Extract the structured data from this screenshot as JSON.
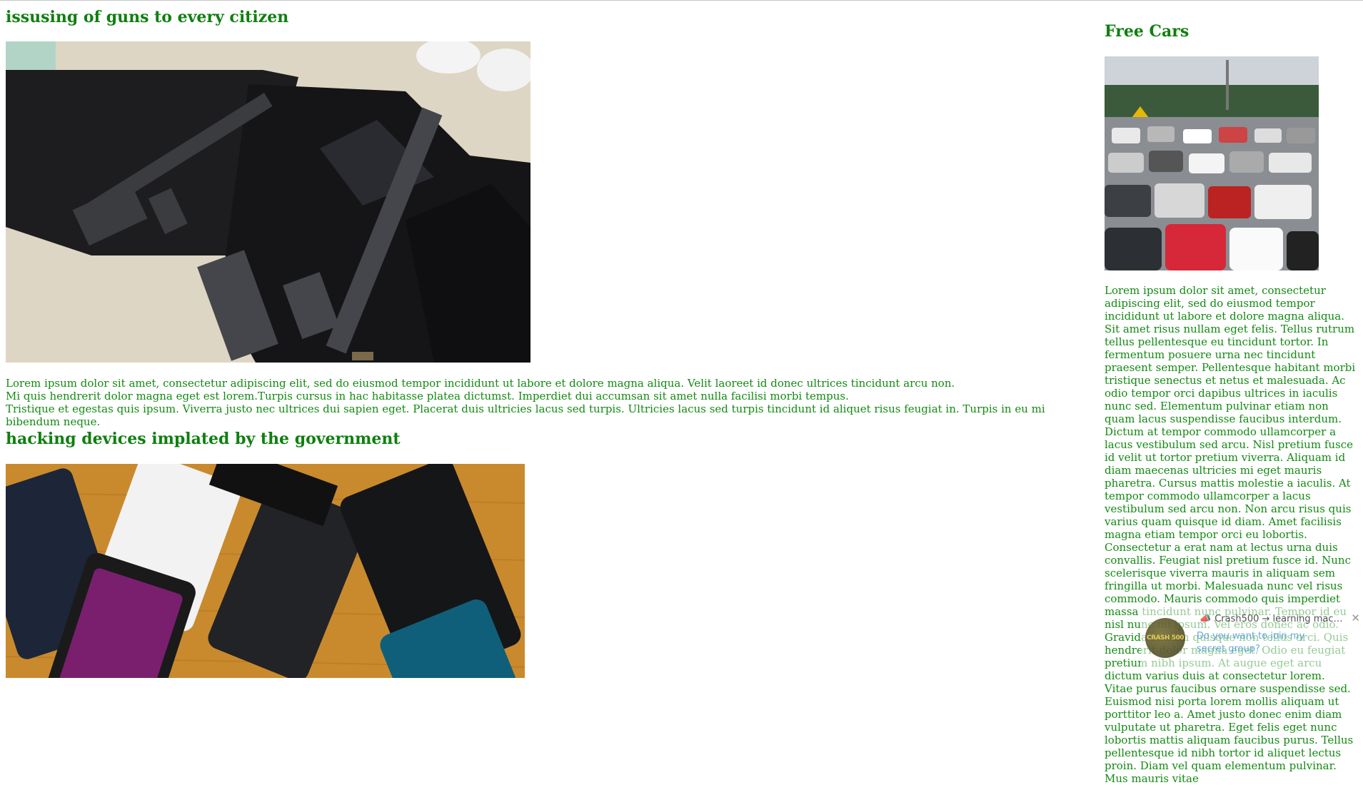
{
  "posts": [
    {
      "title": "issusing of guns to every citizen",
      "paragraphs": [
        "Lorem ipsum dolor sit amet, consectetur adipiscing elit, sed do eiusmod tempor incididunt ut labore et dolore magna aliqua. Velit laoreet id donec ultrices tincidunt arcu non.",
        "Mi quis hendrerit dolor magna eget est lorem.Turpis cursus in hac habitasse platea dictumst. Imperdiet dui accumsan sit amet nulla facilisi morbi tempus.",
        "Tristique et egestas quis ipsum. Viverra justo nec ultrices dui sapien eget. Placerat duis ultricies lacus sed turpis. Ultricies lacus sed turpis tincidunt id aliquet risus feugiat in. Turpis in eu mi bibendum neque."
      ]
    },
    {
      "title": "hacking devices implated by the government"
    }
  ],
  "sidebar": {
    "title": "Free Cars",
    "text": "Lorem ipsum dolor sit amet, consectetur adipiscing elit, sed do eiusmod tempor incididunt ut labore et dolore magna aliqua. Sit amet risus nullam eget felis. Tellus rutrum tellus pellentesque eu tincidunt tortor. In fermentum posuere urna nec tincidunt praesent semper. Pellentesque habitant morbi tristique senectus et netus et malesuada. Ac odio tempor orci dapibus ultrices in iaculis nunc sed. Elementum pulvinar etiam non quam lacus suspendisse faucibus interdum. Dictum at tempor commodo ullamcorper a lacus vestibulum sed arcu. Nisl pretium fusce id velit ut tortor pretium viverra. Aliquam id diam maecenas ultricies mi eget mauris pharetra. Cursus mattis molestie a iaculis. At tempor commodo ullamcorper a lacus vestibulum sed arcu non. Non arcu risus quis varius quam quisque id diam. Amet facilisis magna etiam tempor orci eu lobortis. Consectetur a erat nam at lectus urna duis convallis. Feugiat nisl pretium fusce id. Nunc scelerisque viverra mauris in aliquam sem fringilla ut morbi. Malesuada nunc vel risus commodo. Mauris commodo quis imperdiet massa tincidunt nunc pulvinar. Tempor id eu nisl nunc mi ipsum. Vel eros donec ac odio. Gravida rutrum quisque non tellus orci. Quis hendrerit dolor magna eget. Odio eu feugiat pretium nibh ipsum. At augue eget arcu dictum varius duis at consectetur lorem. Vitae purus faucibus ornare suspendisse sed. Euismod nisi porta lorem mollis aliquam ut porttitor leo a. Amet justo donec enim diam vulputate ut pharetra. Eget felis eget nunc lobortis mattis aliquam faucibus purus. Tellus pellentesque id nibh tortor id aliquet lectus proin. Diam vel quam elementum pulvinar. Mus mauris vitae"
  },
  "notification": {
    "sender": "Crash500 → learning machi...",
    "message": "Do you want to join my secret group?",
    "avatar_text": "CRASH 500",
    "close": "✕"
  },
  "colors": {
    "text": "#138a13",
    "heading": "#0f7f0f",
    "link": "#4b9bd8"
  },
  "icons": {
    "close": "close-icon",
    "megaphone": "megaphone-icon"
  }
}
